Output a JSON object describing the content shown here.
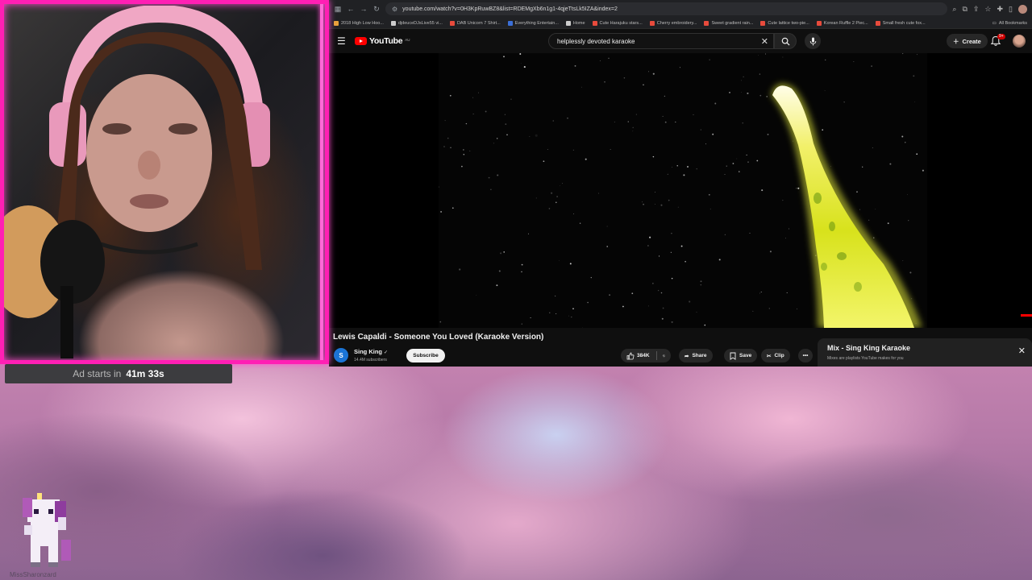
{
  "browser": {
    "url": "youtube.com/watch?v=0H3KpRuwBZ8&list=RDEMgXb6n1g1-4qjeTtsLk5IZA&index=2",
    "bookmarks": [
      {
        "label": "2018 High Low Hoo...",
        "color": "#e8a23a"
      },
      {
        "label": "djdeuceDJsLive55 vi...",
        "color": "#cccccc"
      },
      {
        "label": "DAB Unicorn 7 Shirt...",
        "color": "#e84b3c"
      },
      {
        "label": "Everything Entertain...",
        "color": "#3b6fd8"
      },
      {
        "label": "Home",
        "color": "#cccccc"
      },
      {
        "label": "Cute Harajuku stars...",
        "color": "#e84b3c"
      },
      {
        "label": "Cherry embroidery...",
        "color": "#e84b3c"
      },
      {
        "label": "Sweet gradient rain...",
        "color": "#e84b3c"
      },
      {
        "label": "Cute lattice two-pie...",
        "color": "#e84b3c"
      },
      {
        "label": "Korean Ruffle 2 Piec...",
        "color": "#e84b3c"
      },
      {
        "label": "Small fresh cute fox...",
        "color": "#e84b3c"
      }
    ],
    "all_bookmarks": "All Bookmarks"
  },
  "youtube": {
    "logo": "YouTube",
    "region": "AU",
    "search_query": "helplessly devoted karaoke",
    "create_label": "Create",
    "notifications": "9+",
    "video": {
      "title": "Lewis Capaldi - Someone You Loved (Karaoke Version)",
      "channel": "Sing King",
      "channel_initial": "S",
      "subscribers": "14.4M subscribers",
      "subscribe_label": "Subscribe",
      "likes": "384K",
      "share_label": "Share",
      "save_label": "Save",
      "clip_label": "Clip"
    },
    "mix": {
      "title": "Mix - Sing King Karaoke",
      "subtitle": "Mixes are playlists YouTube makes for you"
    }
  },
  "stream": {
    "ad_label": "Ad starts in",
    "ad_timer": "41m 33s",
    "streamer_name": "MissSharonzard"
  },
  "colors": {
    "neon_border": "#ff1fb4",
    "yt_red": "#ff0000",
    "ad_banner": "#3c3c3f"
  }
}
